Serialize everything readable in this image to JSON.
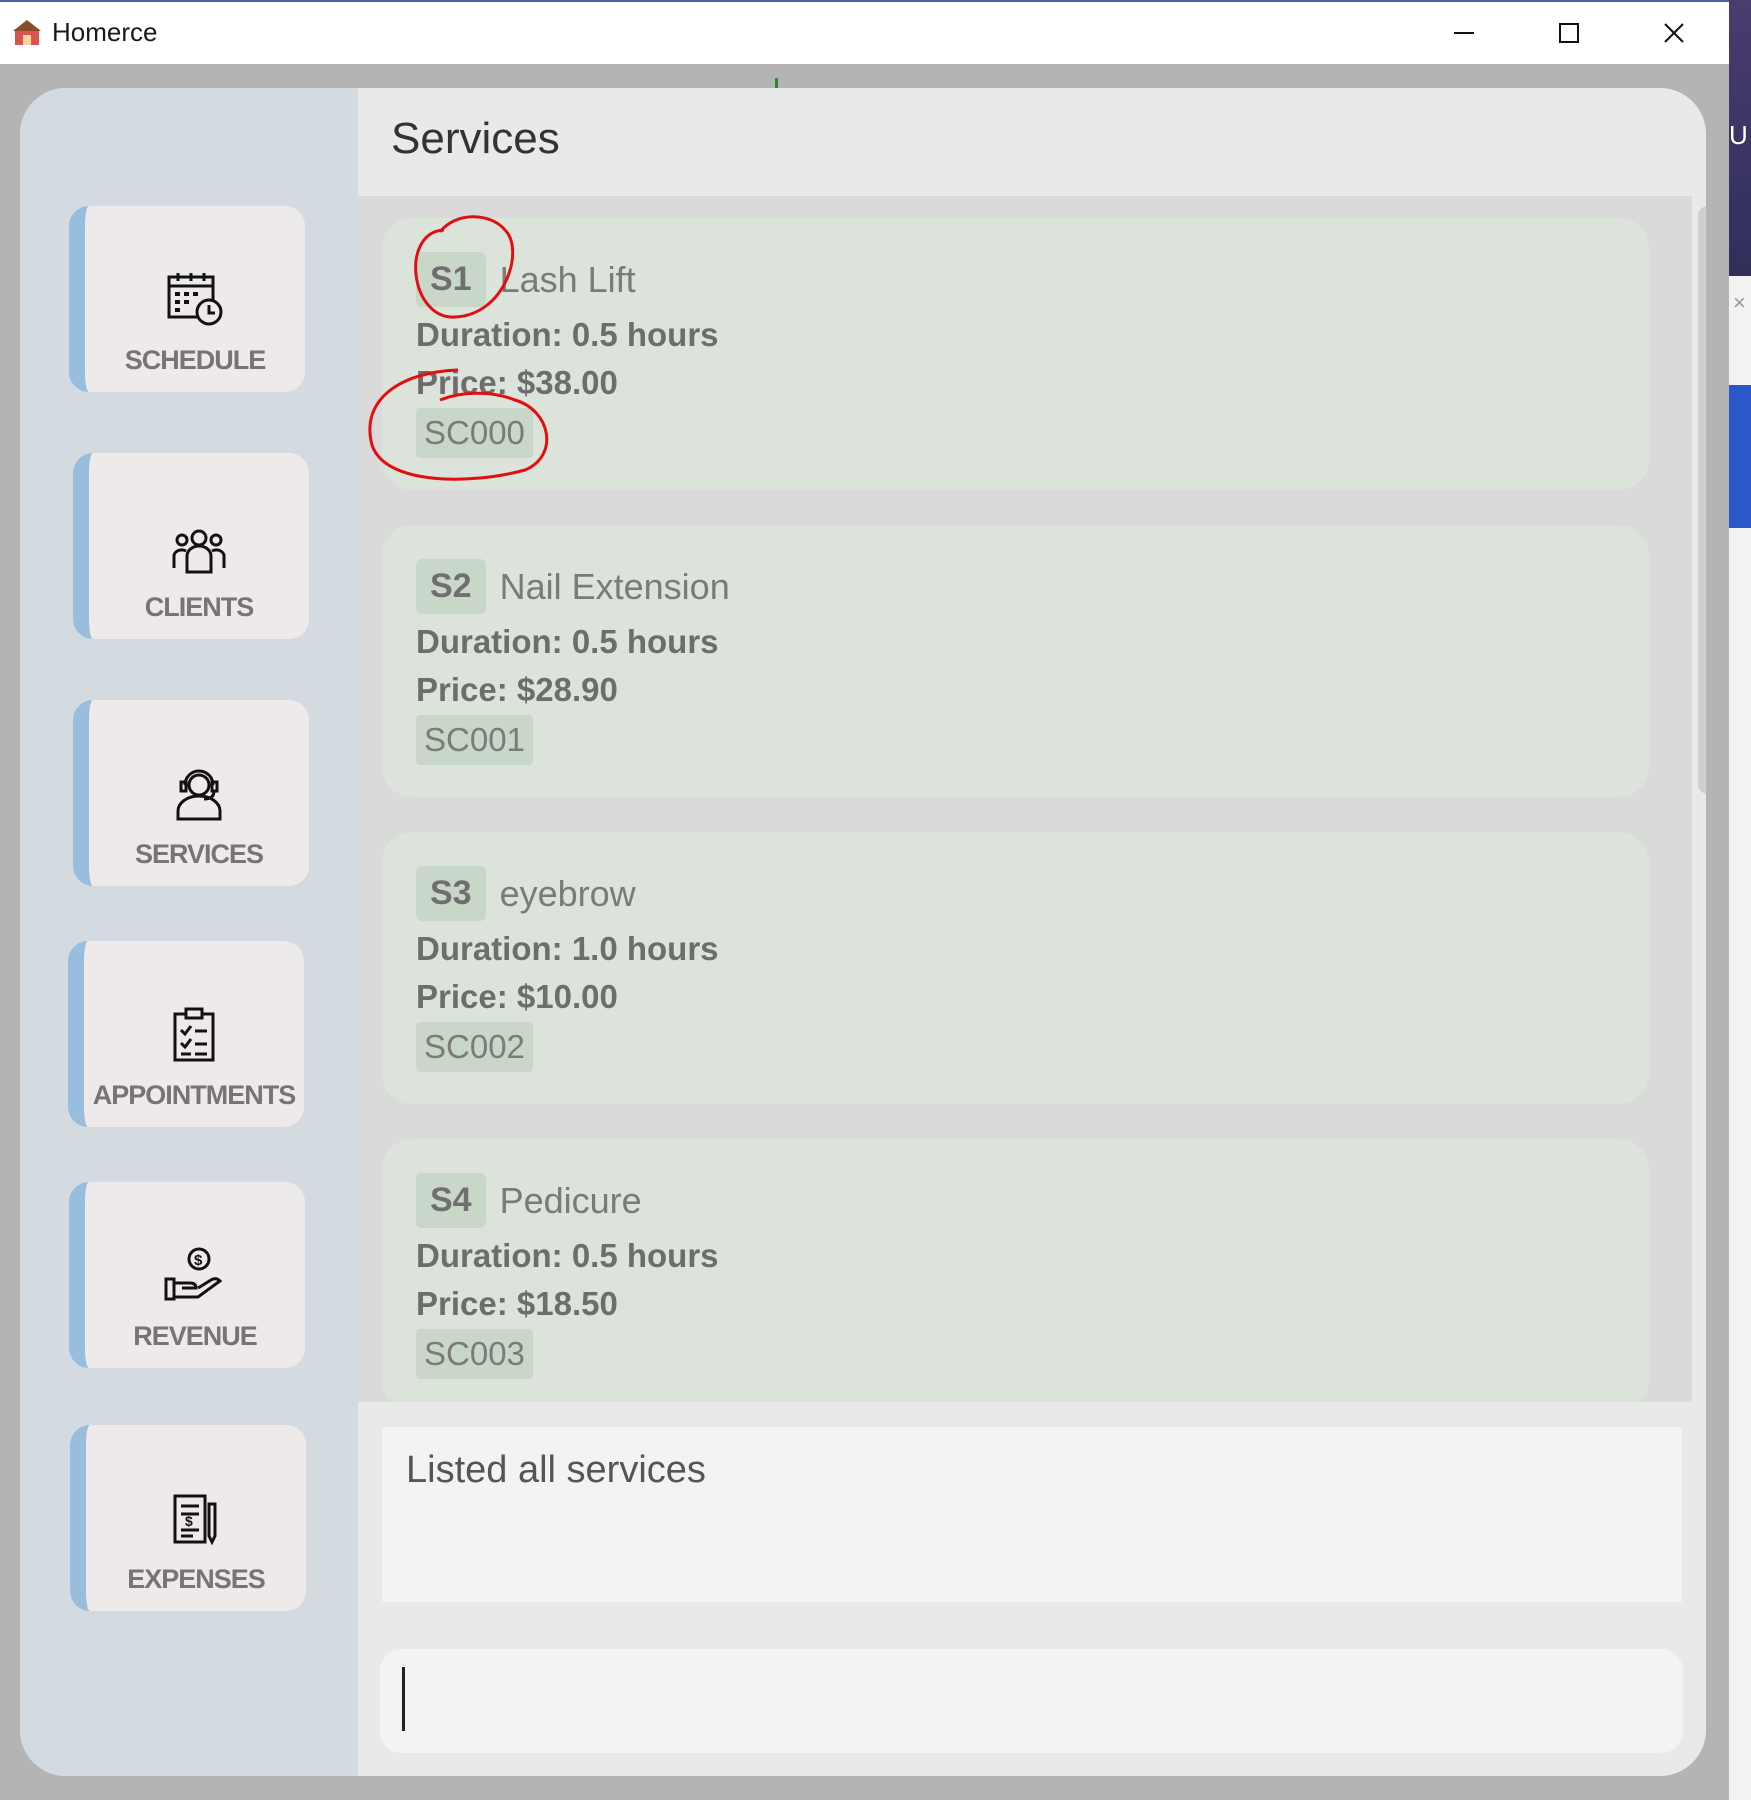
{
  "window": {
    "title": "Homerce"
  },
  "sidebar": {
    "items": [
      {
        "label": "SCHEDULE",
        "icon": "calendar-clock-icon"
      },
      {
        "label": "CLIENTS",
        "icon": "people-group-icon"
      },
      {
        "label": "SERVICES",
        "icon": "headset-person-icon"
      },
      {
        "label": "APPOINTMENTS",
        "icon": "clipboard-checklist-icon"
      },
      {
        "label": "REVENUE",
        "icon": "hand-coin-icon"
      },
      {
        "label": "EXPENSES",
        "icon": "receipt-pen-icon"
      }
    ],
    "accent_color": "#99bedd"
  },
  "main": {
    "title": "Services",
    "services": [
      {
        "id": "S1",
        "name": "Lash Lift",
        "duration": "Duration: 0.5 hours",
        "price": "Price: $38.00",
        "code": "SC000"
      },
      {
        "id": "S2",
        "name": "Nail Extension",
        "duration": "Duration: 0.5 hours",
        "price": "Price: $28.90",
        "code": "SC001"
      },
      {
        "id": "S3",
        "name": "eyebrow",
        "duration": "Duration: 1.0 hours",
        "price": "Price: $10.00",
        "code": "SC002"
      },
      {
        "id": "S4",
        "name": "Pedicure",
        "duration": "Duration: 0.5 hours",
        "price": "Price: $18.50",
        "code": "SC003"
      }
    ],
    "result": "Listed all services",
    "command": {
      "value": "",
      "placeholder": ""
    }
  },
  "colors": {
    "annotation": "#e01010",
    "card_bg": "#dbe3da",
    "tag_bg": "#c9d7c8"
  }
}
